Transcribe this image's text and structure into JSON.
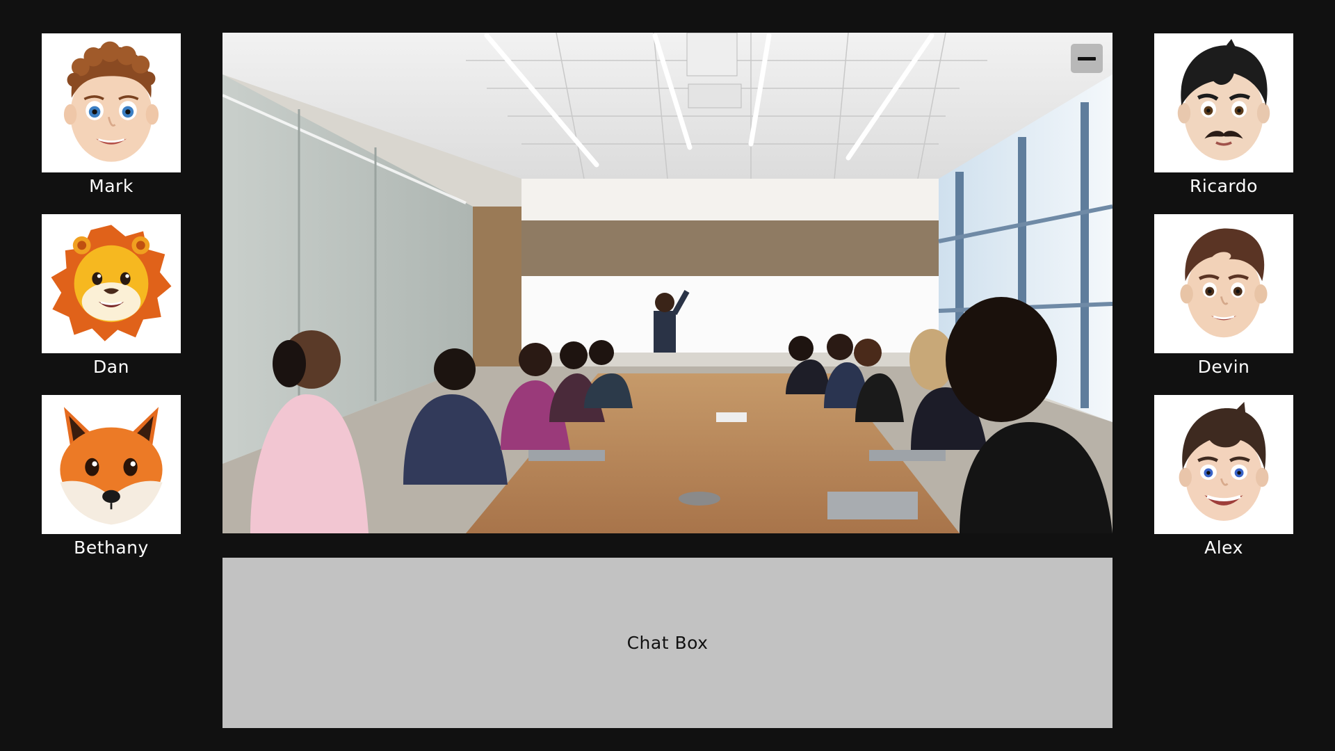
{
  "participants": {
    "left": [
      {
        "name": "Mark",
        "avatar_icon": "memoji-curly-hair-boy-icon"
      },
      {
        "name": "Dan",
        "avatar_icon": "lion-memoji-icon"
      },
      {
        "name": "Bethany",
        "avatar_icon": "fox-memoji-icon"
      }
    ],
    "right": [
      {
        "name": "Ricardo",
        "avatar_icon": "memoji-mustache-man-icon"
      },
      {
        "name": "Devin",
        "avatar_icon": "memoji-brown-hair-man-icon"
      },
      {
        "name": "Alex",
        "avatar_icon": "memoji-smiling-boy-icon"
      }
    ]
  },
  "main_video": {
    "scene": "conference-room-meeting",
    "minimize_icon": "minimize-icon"
  },
  "chat": {
    "label": "Chat Box"
  },
  "colors": {
    "background": "#111111",
    "tile_background": "#ffffff",
    "chat_background": "#c2c2c2",
    "name_text": "#ffffff"
  }
}
